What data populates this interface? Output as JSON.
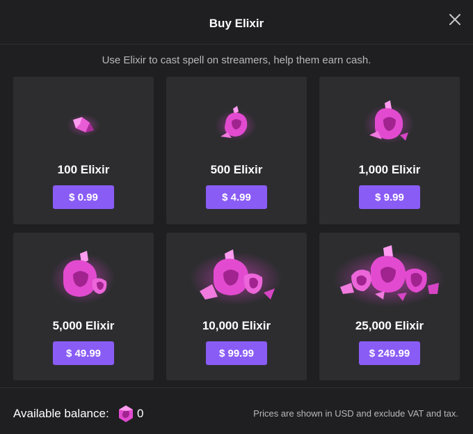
{
  "dialog": {
    "title": "Buy Elixir",
    "subtitle": "Use Elixir to cast spell on streamers, help them earn cash.",
    "close_icon": "close-icon"
  },
  "packages": [
    {
      "amount": "100 Elixir",
      "price": "$ 0.99",
      "icon": "elixir-crystal-icon"
    },
    {
      "amount": "500 Elixir",
      "price": "$ 4.99",
      "icon": "elixir-crystal-icon"
    },
    {
      "amount": "1,000 Elixir",
      "price": "$ 9.99",
      "icon": "elixir-crystal-icon"
    },
    {
      "amount": "5,000 Elixir",
      "price": "$ 49.99",
      "icon": "elixir-crystal-icon"
    },
    {
      "amount": "10,000 Elixir",
      "price": "$ 99.99",
      "icon": "elixir-crystal-icon"
    },
    {
      "amount": "25,000 Elixir",
      "price": "$ 249.99",
      "icon": "elixir-crystal-icon"
    }
  ],
  "footer": {
    "balance_label": "Available balance:",
    "balance_value": "0",
    "disclaimer": "Prices are shown in USD and exclude VAT and tax."
  },
  "colors": {
    "background": "#1f1f22",
    "card": "#2d2d30",
    "button": "#8a5cf6",
    "crystal": "#e24bd0"
  }
}
